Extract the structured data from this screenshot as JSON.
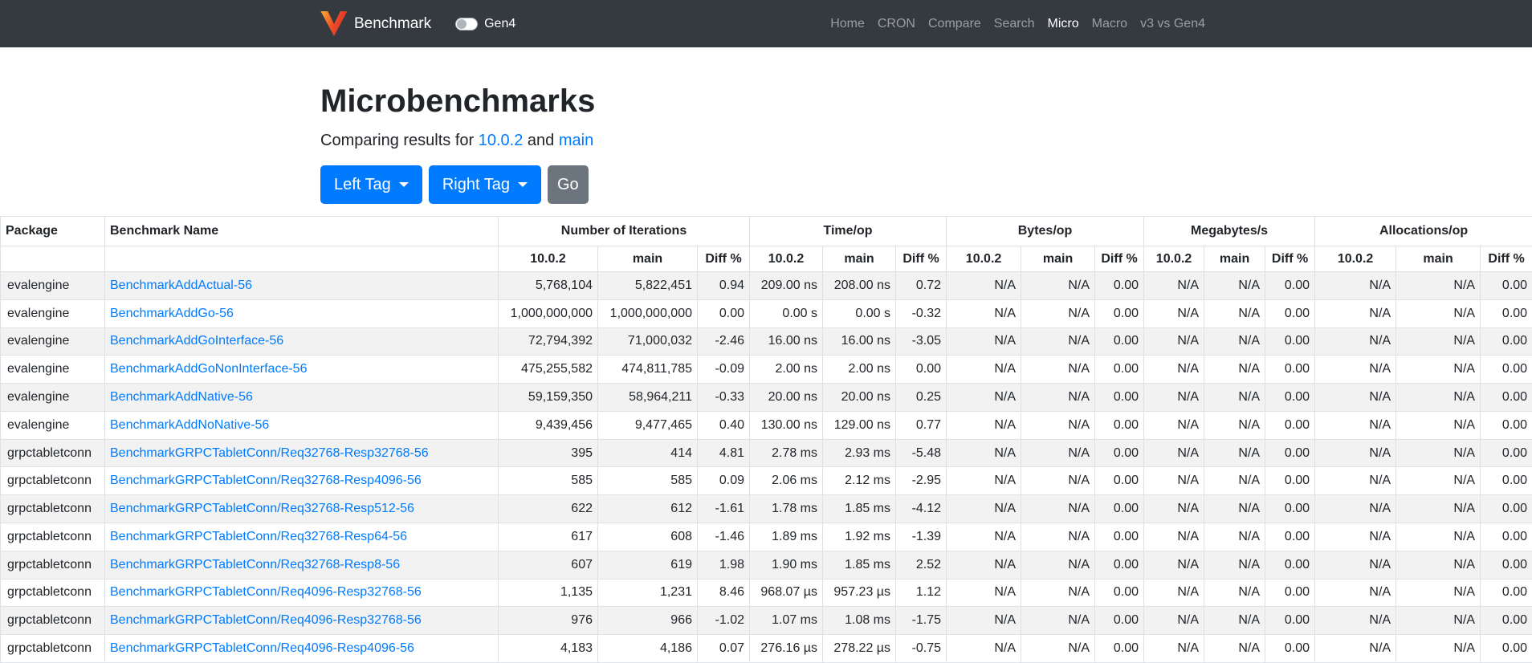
{
  "navbar": {
    "brand": "Benchmark",
    "toggle_label": "Gen4",
    "links": [
      {
        "label": "Home",
        "active": false
      },
      {
        "label": "CRON",
        "active": false
      },
      {
        "label": "Compare",
        "active": false
      },
      {
        "label": "Search",
        "active": false
      },
      {
        "label": "Micro",
        "active": true
      },
      {
        "label": "Macro",
        "active": false
      },
      {
        "label": "v3 vs Gen4",
        "active": false
      }
    ]
  },
  "header": {
    "title": "Microbenchmarks",
    "subtitle_prefix": "Comparing results for ",
    "left_ref": "10.0.2",
    "subtitle_and": " and ",
    "right_ref": "main",
    "left_tag_button": "Left Tag",
    "right_tag_button": "Right Tag",
    "go_button": "Go"
  },
  "colors": {
    "navbar_bg": "#343a40",
    "primary": "#007bff",
    "secondary": "#6c757d",
    "link": "#007bff",
    "stripe": "#f2f2f2",
    "border": "#dee2e6",
    "logo_orange": "#fbb034",
    "logo_red": "#d63031"
  },
  "table": {
    "package_header": "Package",
    "benchmark_header": "Benchmark Name",
    "groups": [
      "Number of Iterations",
      "Time/op",
      "Bytes/op",
      "Megabytes/s",
      "Allocations/op"
    ],
    "sub_headers": [
      "10.0.2",
      "main",
      "Diff %"
    ],
    "rows": [
      {
        "package": "evalengine",
        "name": "BenchmarkAddActual-56",
        "iterations": [
          "5,768,104",
          "5,822,451",
          "0.94"
        ],
        "time": [
          "209.00 ns",
          "208.00 ns",
          "0.72"
        ],
        "bytes": [
          "N/A",
          "N/A",
          "0.00"
        ],
        "megabytes": [
          "N/A",
          "N/A",
          "0.00"
        ],
        "allocations": [
          "N/A",
          "N/A",
          "0.00"
        ]
      },
      {
        "package": "evalengine",
        "name": "BenchmarkAddGo-56",
        "iterations": [
          "1,000,000,000",
          "1,000,000,000",
          "0.00"
        ],
        "time": [
          "0.00 s",
          "0.00 s",
          "-0.32"
        ],
        "bytes": [
          "N/A",
          "N/A",
          "0.00"
        ],
        "megabytes": [
          "N/A",
          "N/A",
          "0.00"
        ],
        "allocations": [
          "N/A",
          "N/A",
          "0.00"
        ]
      },
      {
        "package": "evalengine",
        "name": "BenchmarkAddGoInterface-56",
        "iterations": [
          "72,794,392",
          "71,000,032",
          "-2.46"
        ],
        "time": [
          "16.00 ns",
          "16.00 ns",
          "-3.05"
        ],
        "bytes": [
          "N/A",
          "N/A",
          "0.00"
        ],
        "megabytes": [
          "N/A",
          "N/A",
          "0.00"
        ],
        "allocations": [
          "N/A",
          "N/A",
          "0.00"
        ]
      },
      {
        "package": "evalengine",
        "name": "BenchmarkAddGoNonInterface-56",
        "iterations": [
          "475,255,582",
          "474,811,785",
          "-0.09"
        ],
        "time": [
          "2.00 ns",
          "2.00 ns",
          "0.00"
        ],
        "bytes": [
          "N/A",
          "N/A",
          "0.00"
        ],
        "megabytes": [
          "N/A",
          "N/A",
          "0.00"
        ],
        "allocations": [
          "N/A",
          "N/A",
          "0.00"
        ]
      },
      {
        "package": "evalengine",
        "name": "BenchmarkAddNative-56",
        "iterations": [
          "59,159,350",
          "58,964,211",
          "-0.33"
        ],
        "time": [
          "20.00 ns",
          "20.00 ns",
          "0.25"
        ],
        "bytes": [
          "N/A",
          "N/A",
          "0.00"
        ],
        "megabytes": [
          "N/A",
          "N/A",
          "0.00"
        ],
        "allocations": [
          "N/A",
          "N/A",
          "0.00"
        ]
      },
      {
        "package": "evalengine",
        "name": "BenchmarkAddNoNative-56",
        "iterations": [
          "9,439,456",
          "9,477,465",
          "0.40"
        ],
        "time": [
          "130.00 ns",
          "129.00 ns",
          "0.77"
        ],
        "bytes": [
          "N/A",
          "N/A",
          "0.00"
        ],
        "megabytes": [
          "N/A",
          "N/A",
          "0.00"
        ],
        "allocations": [
          "N/A",
          "N/A",
          "0.00"
        ]
      },
      {
        "package": "grpctabletconn",
        "name": "BenchmarkGRPCTabletConn/Req32768-Resp32768-56",
        "iterations": [
          "395",
          "414",
          "4.81"
        ],
        "time": [
          "2.78 ms",
          "2.93 ms",
          "-5.48"
        ],
        "bytes": [
          "N/A",
          "N/A",
          "0.00"
        ],
        "megabytes": [
          "N/A",
          "N/A",
          "0.00"
        ],
        "allocations": [
          "N/A",
          "N/A",
          "0.00"
        ]
      },
      {
        "package": "grpctabletconn",
        "name": "BenchmarkGRPCTabletConn/Req32768-Resp4096-56",
        "iterations": [
          "585",
          "585",
          "0.09"
        ],
        "time": [
          "2.06 ms",
          "2.12 ms",
          "-2.95"
        ],
        "bytes": [
          "N/A",
          "N/A",
          "0.00"
        ],
        "megabytes": [
          "N/A",
          "N/A",
          "0.00"
        ],
        "allocations": [
          "N/A",
          "N/A",
          "0.00"
        ]
      },
      {
        "package": "grpctabletconn",
        "name": "BenchmarkGRPCTabletConn/Req32768-Resp512-56",
        "iterations": [
          "622",
          "612",
          "-1.61"
        ],
        "time": [
          "1.78 ms",
          "1.85 ms",
          "-4.12"
        ],
        "bytes": [
          "N/A",
          "N/A",
          "0.00"
        ],
        "megabytes": [
          "N/A",
          "N/A",
          "0.00"
        ],
        "allocations": [
          "N/A",
          "N/A",
          "0.00"
        ]
      },
      {
        "package": "grpctabletconn",
        "name": "BenchmarkGRPCTabletConn/Req32768-Resp64-56",
        "iterations": [
          "617",
          "608",
          "-1.46"
        ],
        "time": [
          "1.89 ms",
          "1.92 ms",
          "-1.39"
        ],
        "bytes": [
          "N/A",
          "N/A",
          "0.00"
        ],
        "megabytes": [
          "N/A",
          "N/A",
          "0.00"
        ],
        "allocations": [
          "N/A",
          "N/A",
          "0.00"
        ]
      },
      {
        "package": "grpctabletconn",
        "name": "BenchmarkGRPCTabletConn/Req32768-Resp8-56",
        "iterations": [
          "607",
          "619",
          "1.98"
        ],
        "time": [
          "1.90 ms",
          "1.85 ms",
          "2.52"
        ],
        "bytes": [
          "N/A",
          "N/A",
          "0.00"
        ],
        "megabytes": [
          "N/A",
          "N/A",
          "0.00"
        ],
        "allocations": [
          "N/A",
          "N/A",
          "0.00"
        ]
      },
      {
        "package": "grpctabletconn",
        "name": "BenchmarkGRPCTabletConn/Req4096-Resp32768-56",
        "iterations": [
          "1,135",
          "1,231",
          "8.46"
        ],
        "time": [
          "968.07 µs",
          "957.23 µs",
          "1.12"
        ],
        "bytes": [
          "N/A",
          "N/A",
          "0.00"
        ],
        "megabytes": [
          "N/A",
          "N/A",
          "0.00"
        ],
        "allocations": [
          "N/A",
          "N/A",
          "0.00"
        ]
      },
      {
        "package": "grpctabletconn",
        "name": "BenchmarkGRPCTabletConn/Req4096-Resp32768-56",
        "iterations": [
          "976",
          "966",
          "-1.02"
        ],
        "time": [
          "1.07 ms",
          "1.08 ms",
          "-1.75"
        ],
        "bytes": [
          "N/A",
          "N/A",
          "0.00"
        ],
        "megabytes": [
          "N/A",
          "N/A",
          "0.00"
        ],
        "allocations": [
          "N/A",
          "N/A",
          "0.00"
        ]
      },
      {
        "package": "grpctabletconn",
        "name": "BenchmarkGRPCTabletConn/Req4096-Resp4096-56",
        "iterations": [
          "4,183",
          "4,186",
          "0.07"
        ],
        "time": [
          "276.16 µs",
          "278.22 µs",
          "-0.75"
        ],
        "bytes": [
          "N/A",
          "N/A",
          "0.00"
        ],
        "megabytes": [
          "N/A",
          "N/A",
          "0.00"
        ],
        "allocations": [
          "N/A",
          "N/A",
          "0.00"
        ]
      }
    ]
  }
}
